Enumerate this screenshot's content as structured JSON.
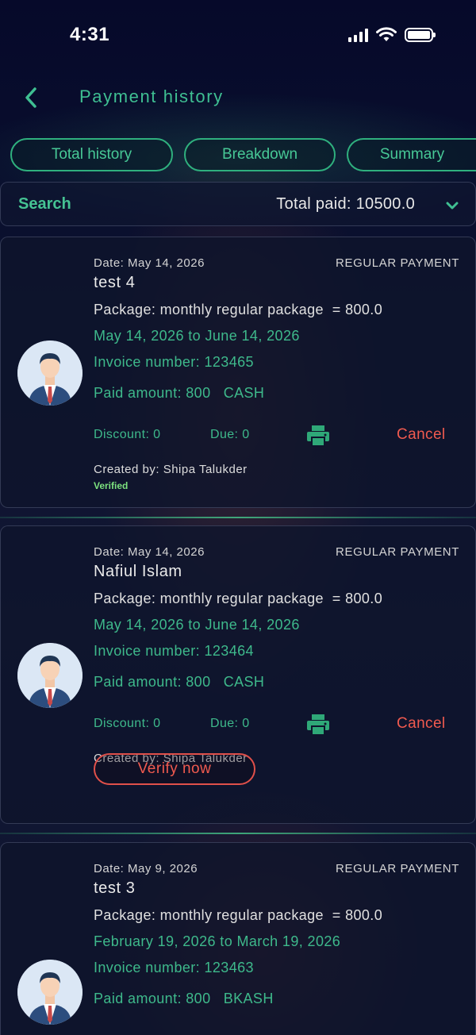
{
  "status_bar": {
    "time": "4:31"
  },
  "header": {
    "title": "Payment history"
  },
  "tabs": [
    {
      "label": "Total history"
    },
    {
      "label": "Breakdown"
    },
    {
      "label": "Summary"
    }
  ],
  "search": {
    "label": "Search",
    "total_paid": "Total paid: 10500.0"
  },
  "payments": [
    {
      "date": "Date: May 14, 2026",
      "type": "REGULAR PAYMENT",
      "name": "test 4",
      "package": "Package: monthly regular package  = 800.0",
      "period": "May 14, 2026 to June 14, 2026",
      "invoice": "Invoice number: 123465",
      "paid": "Paid amount: 800   CASH",
      "discount": "Discount: 0",
      "due": "Due: 0",
      "cancel": "Cancel",
      "created_by": "Created by: Shipa Talukder",
      "verified": "Verified"
    },
    {
      "date": "Date: May 14, 2026",
      "type": "REGULAR PAYMENT",
      "name": "Nafiul Islam",
      "package": "Package: monthly regular package  = 800.0",
      "period": "May 14, 2026 to June 14, 2026",
      "invoice": "Invoice number: 123464",
      "paid": "Paid amount: 800   CASH",
      "discount": "Discount: 0",
      "due": "Due: 0",
      "cancel": "Cancel",
      "created_by": "Created by: Shipa Talukder",
      "verify_button": "Verify now"
    },
    {
      "date": "Date: May 9, 2026",
      "type": "REGULAR PAYMENT",
      "name": "test 3",
      "package": "Package: monthly regular package  = 800.0",
      "period": "February 19, 2026 to March 19, 2026",
      "invoice": "Invoice number: 123463",
      "paid": "Paid amount: 800   BKASH"
    }
  ],
  "colors": {
    "accent_green": "#3eb98b",
    "cancel_red": "#f05a4f",
    "verified_green": "#7de27f",
    "background": "#070b26"
  },
  "icons": [
    "back-arrow-icon",
    "signal-icon",
    "wifi-icon",
    "battery-icon",
    "chevron-down-icon",
    "avatar-icon",
    "print-icon"
  ]
}
